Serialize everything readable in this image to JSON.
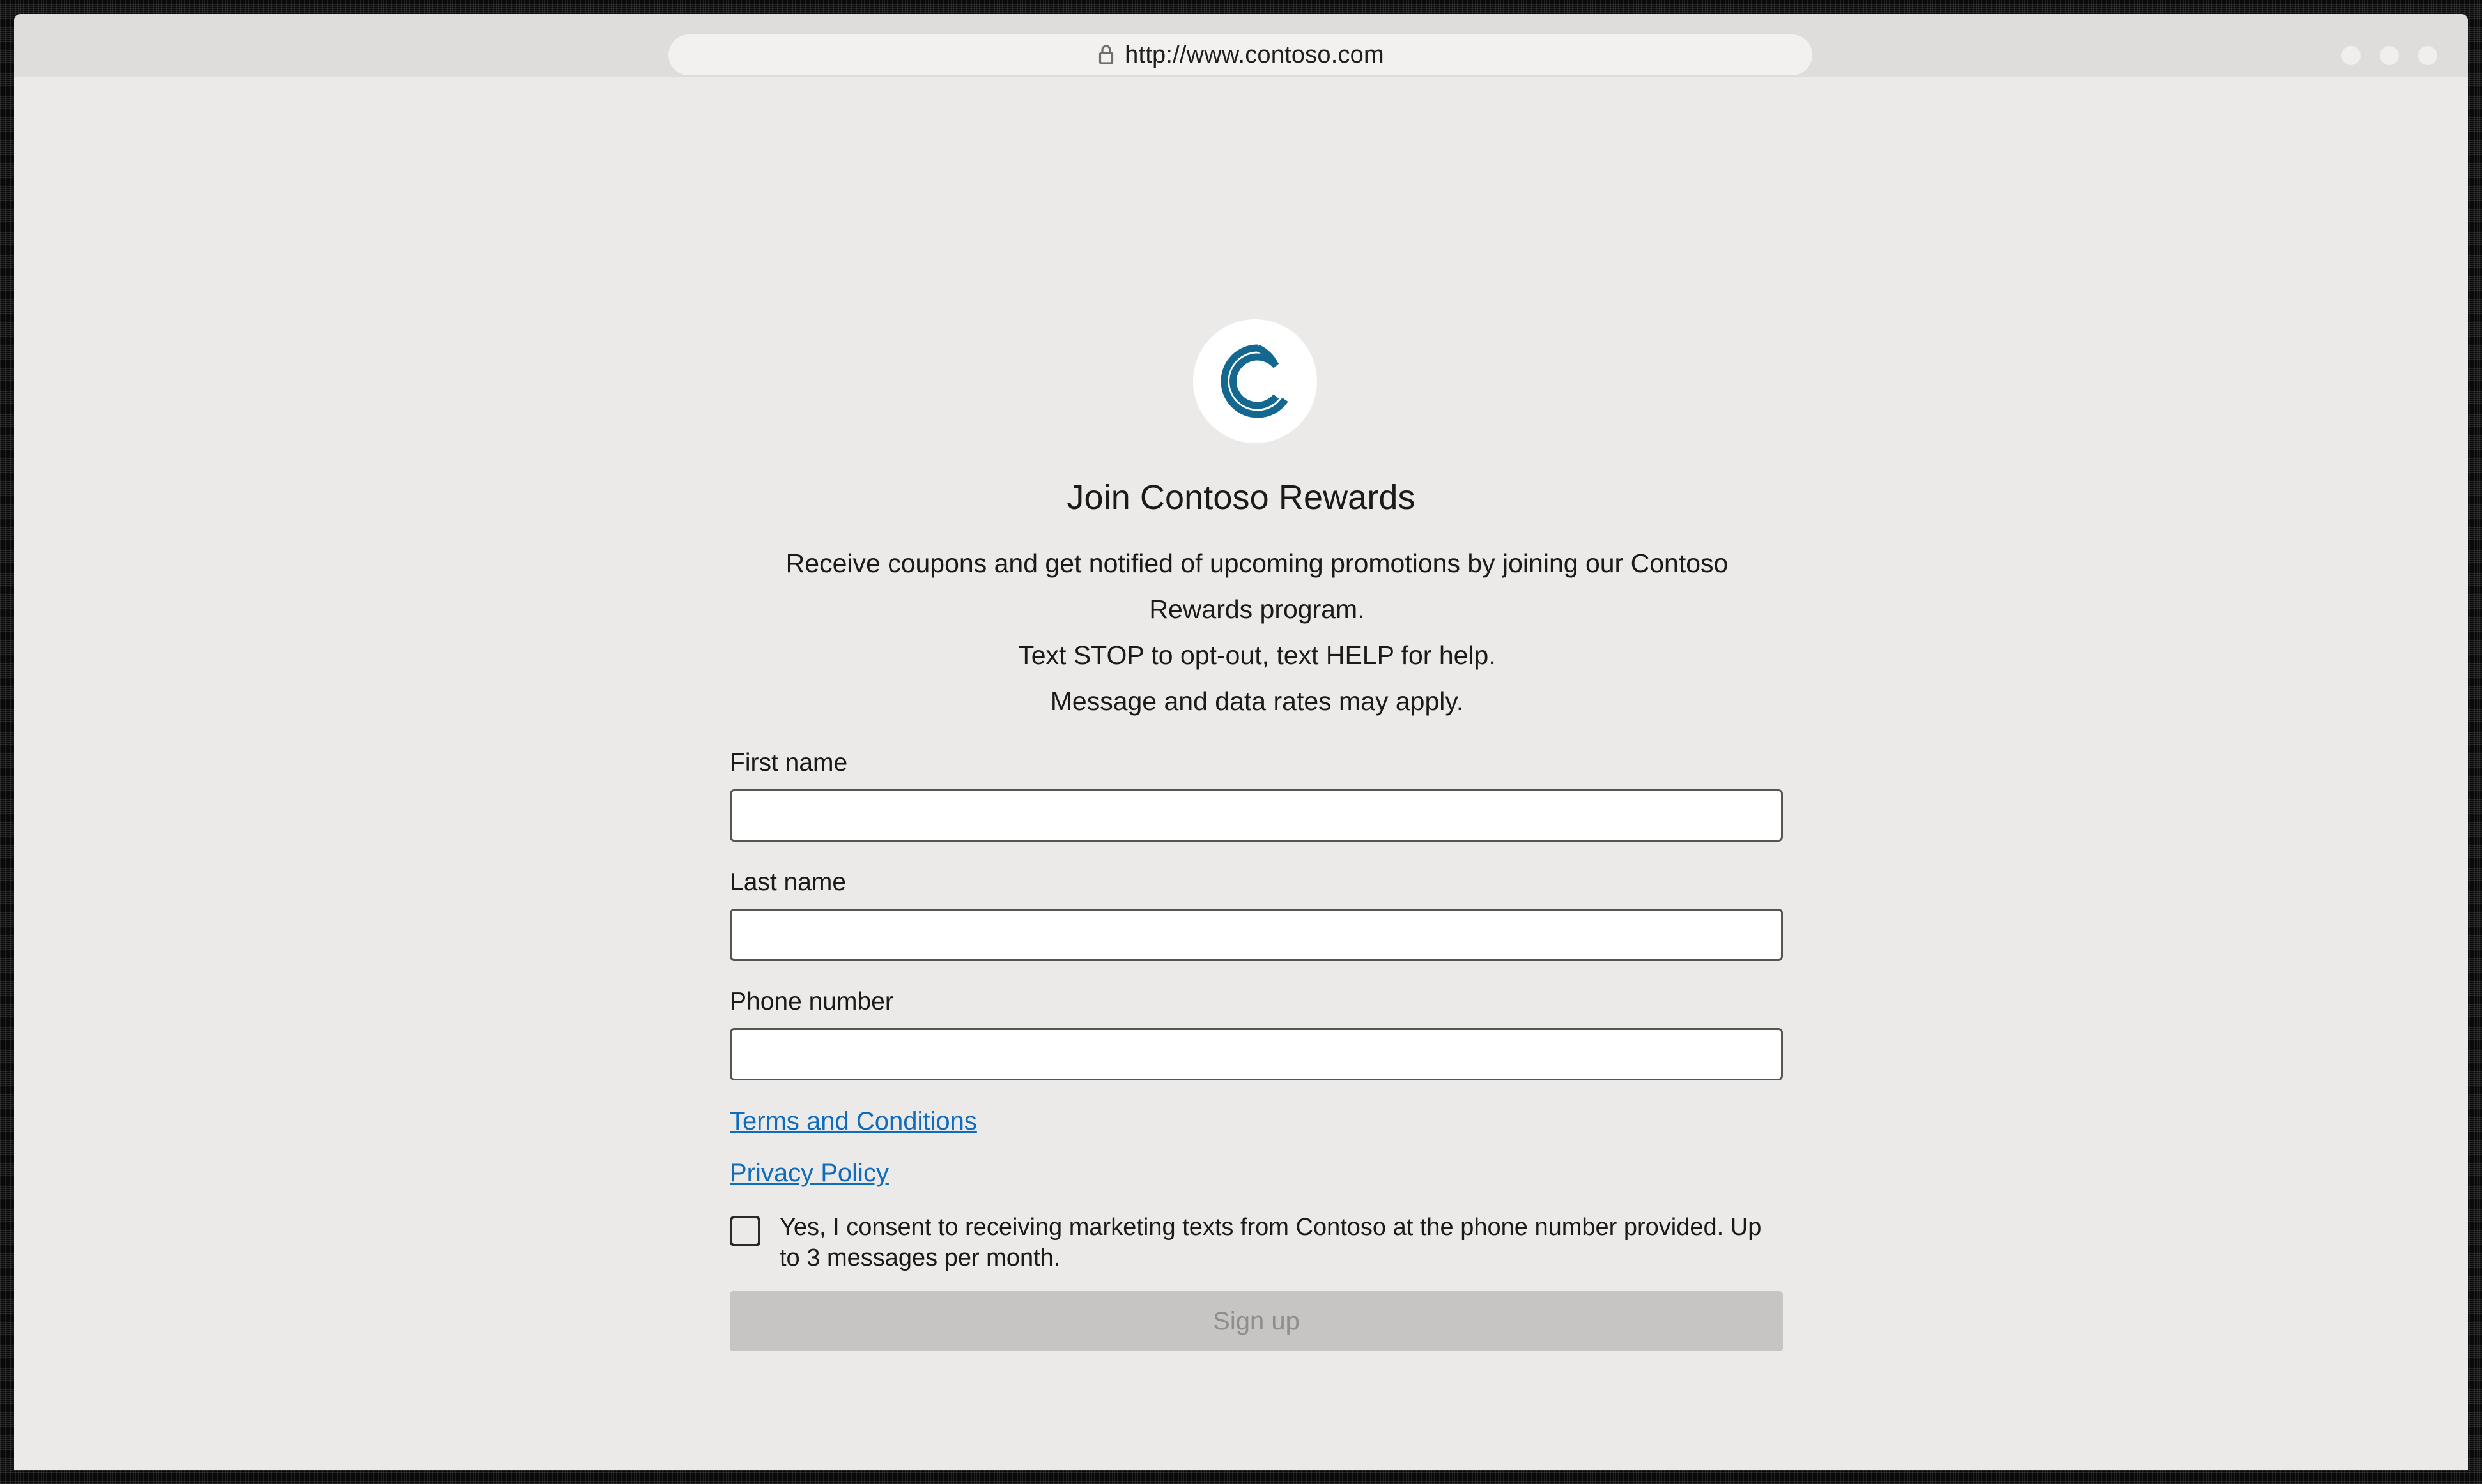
{
  "browser": {
    "url": "http://www.contoso.com",
    "lock_icon": "lock-icon",
    "window_dots": [
      "minimize-dot",
      "maximize-dot",
      "close-dot"
    ]
  },
  "page": {
    "logo_icon": "contoso-double-c-logo-icon",
    "title": "Join Contoso Rewards",
    "intro_paragraph": "Receive coupons and get notified of upcoming promotions by joining our Contoso Rewards program.",
    "sms_line_1": "Text STOP to opt-out, text HELP for help.",
    "sms_line_2": "Message and data rates may apply."
  },
  "form": {
    "first_name": {
      "label": "First name",
      "value": "",
      "placeholder": ""
    },
    "last_name": {
      "label": "Last name",
      "value": "",
      "placeholder": ""
    },
    "phone_number": {
      "label": "Phone number",
      "value": "",
      "placeholder": ""
    },
    "terms_link": "Terms and Conditions",
    "privacy_link": "Privacy Policy",
    "consent_text": "Yes, I consent to receiving marketing texts from Contoso at the phone number provided. Up to 3 messages per month.",
    "consent_checked": false,
    "submit_label": "Sign up",
    "submit_disabled": true
  },
  "colors": {
    "page_background": "#eceae8",
    "chrome_background": "#dedddb",
    "url_bar_background": "#f2f1ef",
    "brand_blue": "#14688f",
    "link_blue": "#0f6cbd",
    "text_primary": "#1b1a19",
    "input_border": "#57554f",
    "button_disabled_background": "#c6c5c3",
    "button_disabled_text": "#8f8e8c",
    "frame_border": "#0a0a0a"
  }
}
